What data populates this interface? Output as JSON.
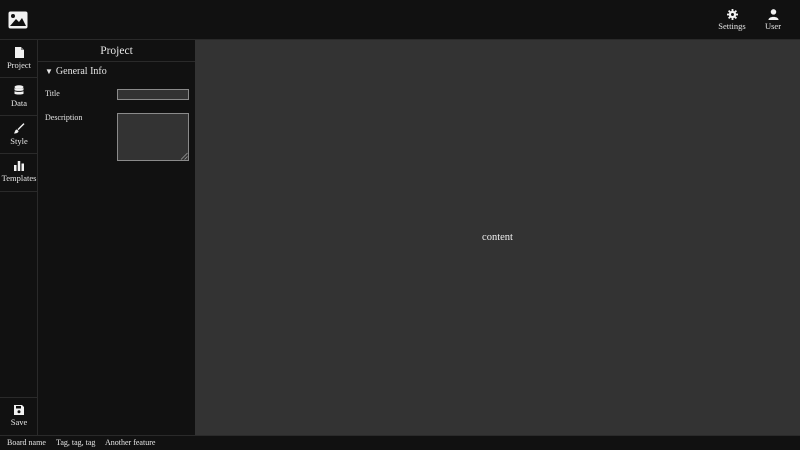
{
  "header": {
    "logo_icon": "image-icon",
    "settings_label": "Settings",
    "settings_icon": "gear-icon",
    "user_label": "User",
    "user_icon": "user-icon"
  },
  "rail": {
    "items": [
      {
        "label": "Project",
        "icon": "file-icon"
      },
      {
        "label": "Data",
        "icon": "database-icon"
      },
      {
        "label": "Style",
        "icon": "brush-icon"
      },
      {
        "label": "Templates",
        "icon": "bar-chart-icon"
      }
    ],
    "save_label": "Save",
    "save_icon": "floppy-disk-icon"
  },
  "panel": {
    "title": "Project",
    "section": {
      "label": "General Info",
      "expanded": true,
      "fields": {
        "title_label": "Title",
        "title_value": "",
        "description_label": "Description",
        "description_value": ""
      }
    }
  },
  "main": {
    "placeholder": "content"
  },
  "statusbar": {
    "items": [
      "Board name",
      "Tag, tag, tag",
      "Another feature"
    ]
  },
  "colors": {
    "background": "#111111",
    "content_background": "#333333",
    "text": "#e6e6e6",
    "border": "#2a2a2a"
  }
}
